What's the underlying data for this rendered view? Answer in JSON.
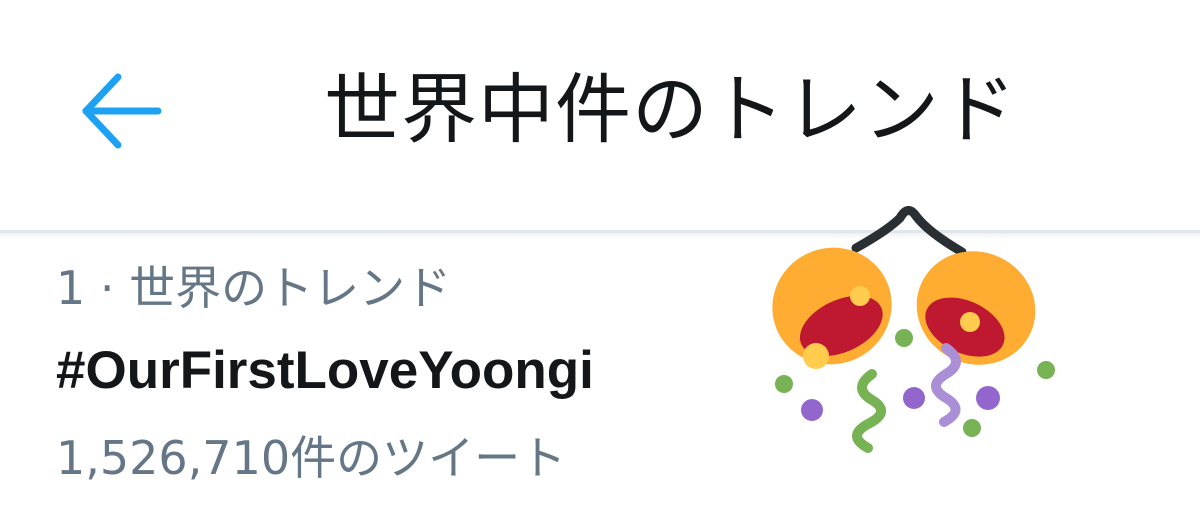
{
  "header": {
    "title": "世界中件のトレンド",
    "back_icon": "arrow-left-icon",
    "accent_color": "#1da1f2"
  },
  "trend": {
    "rank_label": "1 · 世界のトレンド",
    "name": "#OurFirstLoveYoongi",
    "tweet_count": "1,526,710件のツイート",
    "emoji_icon": "party-popper-icon"
  },
  "colors": {
    "primary_text": "#14171a",
    "secondary_text": "#657786",
    "divider": "#e1e6ea"
  }
}
